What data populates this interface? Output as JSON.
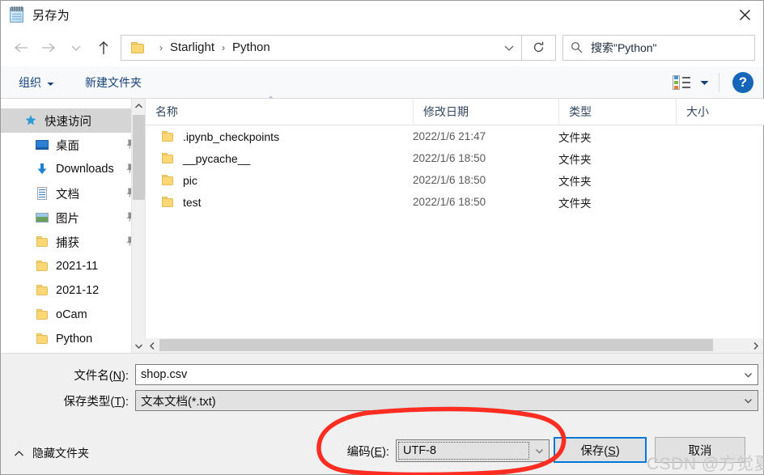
{
  "window": {
    "title": "另存为",
    "title_icon": "notepad-icon",
    "close_label": "✕"
  },
  "nav": {
    "back_icon": "arrow-left-icon",
    "forward_icon": "arrow-right-icon",
    "recent_icon": "chevron-down-icon",
    "up_icon": "arrow-up-icon",
    "breadcrumb": [
      "Starlight",
      "Python"
    ],
    "breadcrumb_separator": "›",
    "dropdown_icon": "chevron-down-icon",
    "refresh_icon": "refresh-icon"
  },
  "search": {
    "icon": "search-icon",
    "placeholder": "搜索\"Python\""
  },
  "toolbar": {
    "organize_label": "组织",
    "organize_caret": "▾",
    "new_folder_label": "新建文件夹",
    "view_icon": "list-view-icon",
    "view_caret": "▾",
    "help_label": "?"
  },
  "sidebar": {
    "items": [
      {
        "label": "快速访问",
        "icon": "quick-access-star-icon",
        "selected": true,
        "pinned": false
      },
      {
        "label": "桌面",
        "icon": "desktop-icon",
        "selected": false,
        "pinned": true
      },
      {
        "label": "Downloads",
        "icon": "downloads-arrow-icon",
        "selected": false,
        "pinned": true
      },
      {
        "label": "文档",
        "icon": "documents-icon",
        "selected": false,
        "pinned": true
      },
      {
        "label": "图片",
        "icon": "pictures-icon",
        "selected": false,
        "pinned": true
      },
      {
        "label": "捕获",
        "icon": "folder-icon",
        "selected": false,
        "pinned": true
      },
      {
        "label": "2021-11",
        "icon": "folder-icon",
        "selected": false,
        "pinned": false
      },
      {
        "label": "2021-12",
        "icon": "folder-icon",
        "selected": false,
        "pinned": false
      },
      {
        "label": "oCam",
        "icon": "folder-icon",
        "selected": false,
        "pinned": false
      },
      {
        "label": "Python",
        "icon": "folder-icon",
        "selected": false,
        "pinned": false
      }
    ],
    "scrollbar": {
      "up_icon": "chevron-up-icon",
      "down_icon": "chevron-down-icon"
    }
  },
  "filelist": {
    "columns": [
      "名称",
      "修改日期",
      "类型",
      "大小"
    ],
    "sort_indicator": "⌃",
    "rows": [
      {
        "name": ".ipynb_checkpoints",
        "date": "2022/1/6 21:47",
        "type": "文件夹",
        "size": "",
        "icon": "folder-icon"
      },
      {
        "name": "__pycache__",
        "date": "2022/1/6 18:50",
        "type": "文件夹",
        "size": "",
        "icon": "folder-icon"
      },
      {
        "name": "pic",
        "date": "2022/1/6 18:50",
        "type": "文件夹",
        "size": "",
        "icon": "folder-icon"
      },
      {
        "name": "test",
        "date": "2022/1/6 18:50",
        "type": "文件夹",
        "size": "",
        "icon": "folder-icon"
      }
    ],
    "hscroll": {
      "left_icon": "chevron-left-icon",
      "right_icon": "chevron-right-icon"
    }
  },
  "form": {
    "filename_label_pre": "文件名(",
    "filename_label_key": "N",
    "filename_label_post": "):",
    "filename_value": "shop.csv",
    "filetype_label_pre": "保存类型(",
    "filetype_label_key": "T",
    "filetype_label_post": "):",
    "filetype_value": "文本文档(*.txt)",
    "encoding_label_pre": "编码(",
    "encoding_label_key": "E",
    "encoding_label_post": "):",
    "encoding_value": "UTF-8",
    "combo_arrow_icon": "chevron-down-icon"
  },
  "buttons": {
    "save_pre": "保存(",
    "save_key": "S",
    "save_post": ")",
    "cancel": "取消"
  },
  "footer": {
    "hide_folders_caret": "∧",
    "hide_folders_label": "隐藏文件夹"
  },
  "watermark": {
    "text": "CSDN @方觉夏"
  },
  "colors": {
    "accent_blue": "#0078d7",
    "annotation_red": "#fe2d21",
    "selection_grey": "#d5d5d5",
    "help_blue": "#1565b8"
  }
}
